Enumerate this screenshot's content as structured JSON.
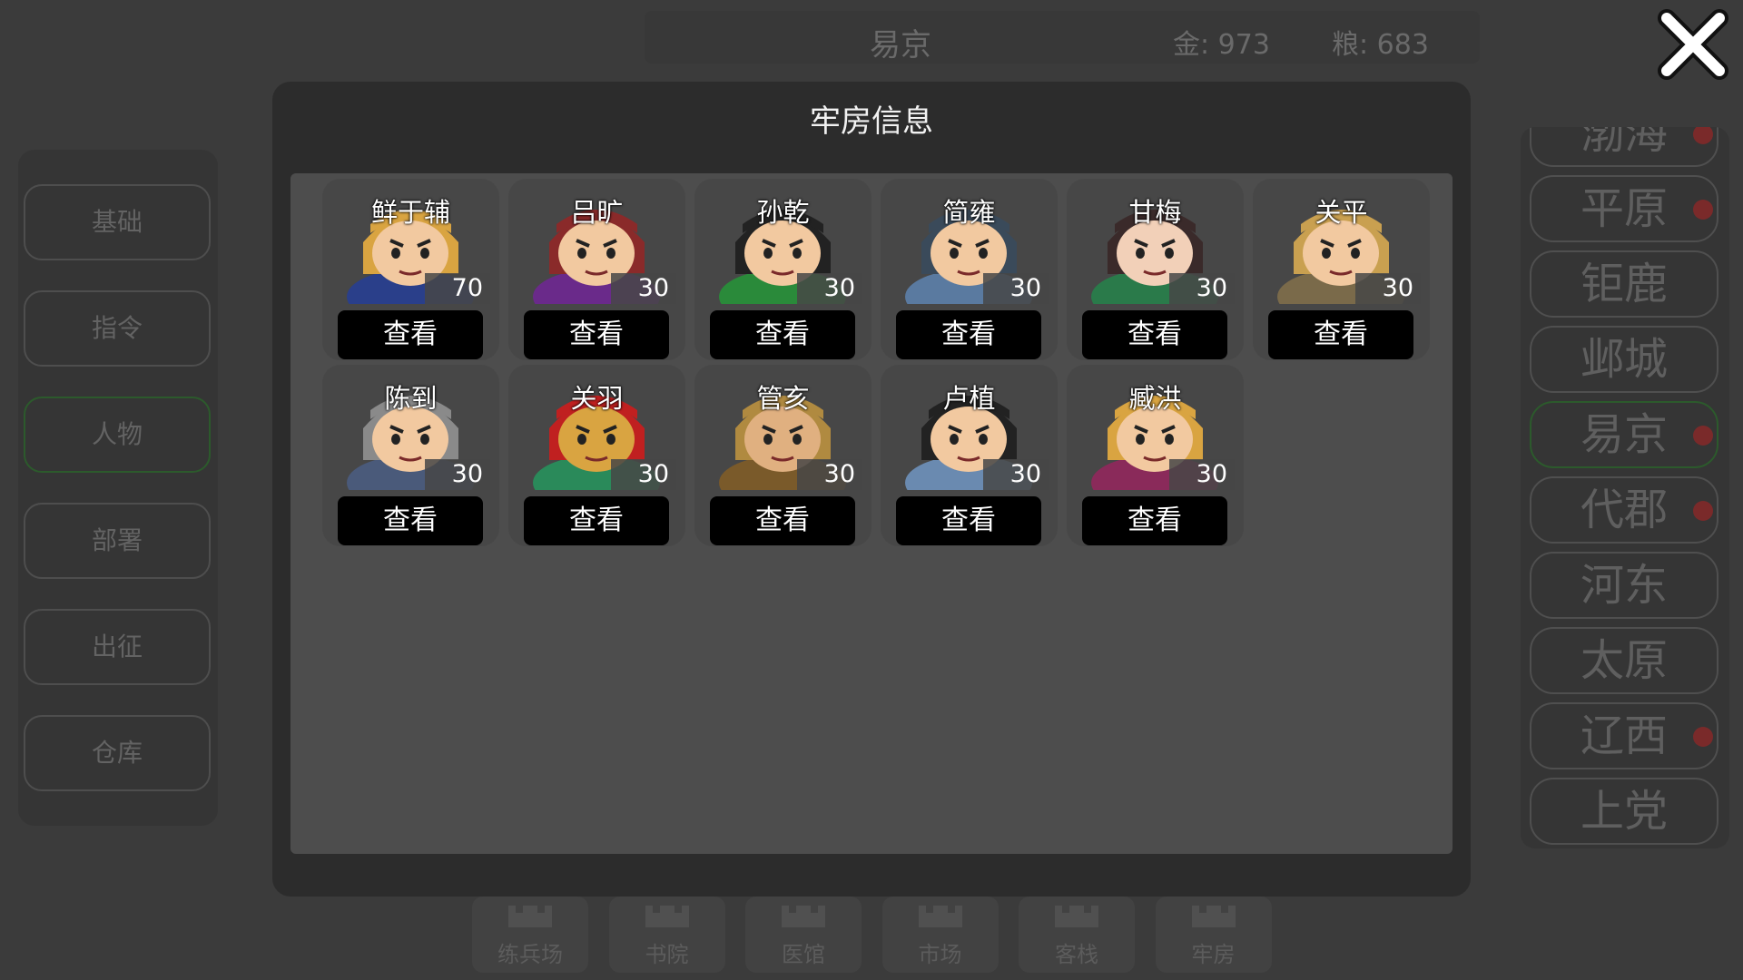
{
  "header": {
    "city": "易京",
    "gold": "金: 973",
    "grain": "粮: 683"
  },
  "left_menu": [
    "基础",
    "指令",
    "人物",
    "部署",
    "出征",
    "仓库"
  ],
  "left_menu_active": 2,
  "cities": [
    {
      "name": "渤海",
      "alert": true
    },
    {
      "name": "平原",
      "alert": true
    },
    {
      "name": "钜鹿",
      "alert": false
    },
    {
      "name": "邺城",
      "alert": false
    },
    {
      "name": "易京",
      "alert": true,
      "active": true
    },
    {
      "name": "代郡",
      "alert": true
    },
    {
      "name": "河东",
      "alert": false
    },
    {
      "name": "太原",
      "alert": false
    },
    {
      "name": "辽西",
      "alert": true
    },
    {
      "name": "上党",
      "alert": false
    }
  ],
  "buildings": [
    "练兵场",
    "书院",
    "医馆",
    "市场",
    "客栈",
    "牢房"
  ],
  "modal": {
    "title": "牢房信息",
    "view_label": "查看",
    "generals": [
      {
        "name": "鲜于辅",
        "level": "70",
        "colors": [
          "#2a3f8a",
          "#d9a441",
          "#f2c9a0"
        ]
      },
      {
        "name": "吕旷",
        "level": "30",
        "colors": [
          "#6a2a8a",
          "#8a2a2a",
          "#f2c9a0"
        ]
      },
      {
        "name": "孙乾",
        "level": "30",
        "colors": [
          "#2a8a3a",
          "#222222",
          "#f2c9a0"
        ]
      },
      {
        "name": "简雍",
        "level": "30",
        "colors": [
          "#5a7aa0",
          "#3a4a5a",
          "#f2c9a0"
        ]
      },
      {
        "name": "甘梅",
        "level": "30",
        "colors": [
          "#2a7a4a",
          "#3a2a2a",
          "#f2d0b8"
        ]
      },
      {
        "name": "关平",
        "level": "30",
        "colors": [
          "#7a6a4a",
          "#c9a050",
          "#f2c9a0"
        ]
      },
      {
        "name": "陈到",
        "level": "30",
        "colors": [
          "#4a5a7a",
          "#8a8a8a",
          "#f2c9a0"
        ]
      },
      {
        "name": "关羽",
        "level": "30",
        "colors": [
          "#2a8a5a",
          "#c02020",
          "#d9a441"
        ]
      },
      {
        "name": "管亥",
        "level": "30",
        "colors": [
          "#7a5a2a",
          "#b08a40",
          "#e0b080"
        ]
      },
      {
        "name": "卢植",
        "level": "30",
        "colors": [
          "#6a8ab0",
          "#222222",
          "#f2c9a0"
        ]
      },
      {
        "name": "臧洪",
        "level": "30",
        "colors": [
          "#8a2a5a",
          "#d9a441",
          "#f2c9a0"
        ]
      }
    ]
  }
}
